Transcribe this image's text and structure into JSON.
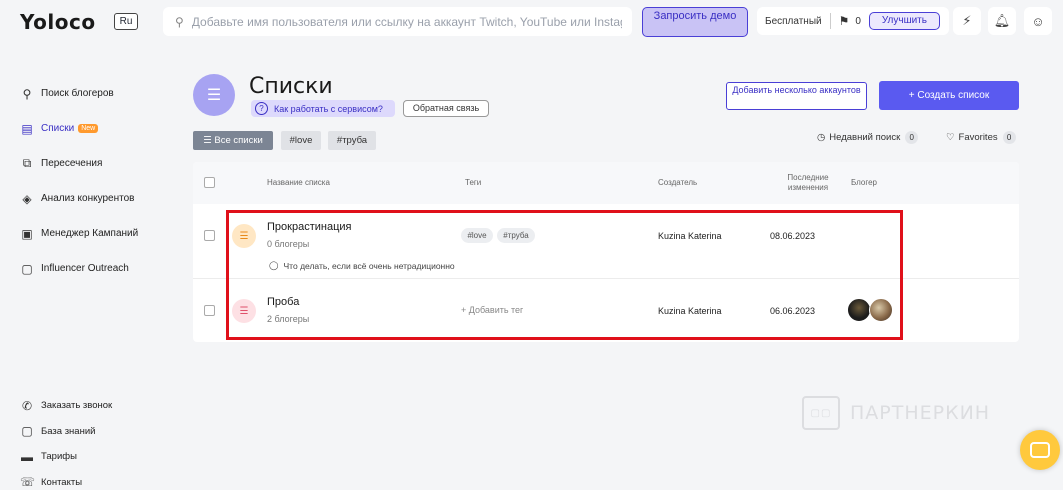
{
  "header": {
    "logo": "Yoloco",
    "lang": "Ru",
    "search_placeholder": "Добавьте имя пользователя или ссылку на аккаунт Twitch, YouTube или Instagram",
    "demo_label": "Запросить демо",
    "plan_label": "Бесплатный",
    "flag_count": "0",
    "upgrade_label": "Улучшить",
    "icons": [
      "bolt-icon",
      "bell-icon",
      "user-icon"
    ]
  },
  "sidebar": {
    "items": [
      {
        "label": "Поиск блогеров",
        "icon": "search-icon"
      },
      {
        "label": "Списки",
        "icon": "list-icon",
        "badge": "New"
      },
      {
        "label": "Пересечения",
        "icon": "intersection-icon"
      },
      {
        "label": "Анализ конкурентов",
        "icon": "tag-icon"
      },
      {
        "label": "Менеджер Кампаний",
        "icon": "campaign-icon"
      },
      {
        "label": "Influencer Outreach",
        "icon": "chat-icon"
      }
    ],
    "bottom": [
      {
        "label": "Заказать звонок",
        "icon": "phone-icon"
      },
      {
        "label": "База знаний",
        "icon": "book-icon"
      },
      {
        "label": "Тарифы",
        "icon": "card-icon"
      },
      {
        "label": "Контакты",
        "icon": "contact-icon"
      }
    ]
  },
  "page": {
    "title": "Списки",
    "how_label": "Как работать с сервисом?",
    "feedback_label": "Обратная связь",
    "add_many_label": "Добавить несколько аккаунтов",
    "create_label": "+ Создать список"
  },
  "filters": {
    "all": "Все списки",
    "tags": [
      "#love",
      "#труба"
    ],
    "recent_label": "Недавний поиск",
    "recent_count": "0",
    "favorites_label": "Favorites",
    "favorites_count": "0"
  },
  "table": {
    "columns": [
      "Название списка",
      "Теги",
      "Создатель",
      "Последние изменения",
      "Блогер"
    ],
    "rows": [
      {
        "title": "Прокрастинация",
        "count": "0 блогеры",
        "note": "Что делать, если всё очень нетрадиционно",
        "tags": [
          "#love",
          "#труба"
        ],
        "creator": "Kuzina Katerina",
        "date": "08.06.2023",
        "icon_color": "#ffe7c4",
        "icon_fg": "#e88a1a"
      },
      {
        "title": "Проба",
        "count": "2 блогеры",
        "add_tag": "+ Добавить тег",
        "creator": "Kuzina Katerina",
        "date": "06.06.2023",
        "icon_color": "#fde0e4",
        "icon_fg": "#e0506a"
      }
    ]
  },
  "watermark": "ПАРТНЕРКИН"
}
